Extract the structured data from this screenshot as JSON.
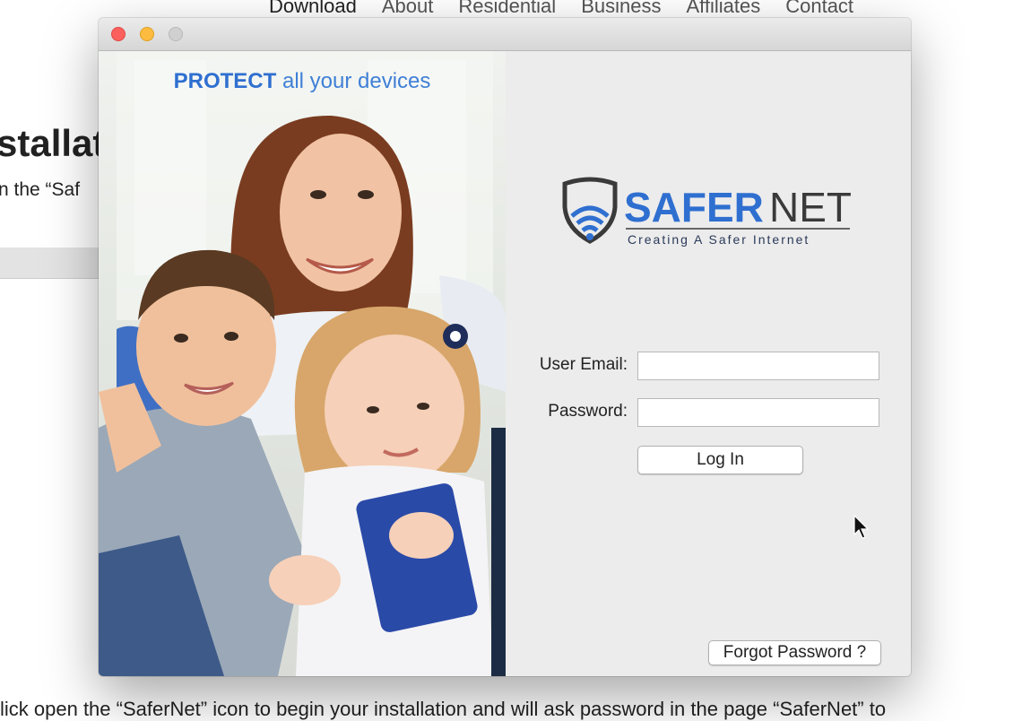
{
  "background_page": {
    "nav": [
      "Download",
      "About",
      "Residential",
      "Business",
      "Affiliates",
      "Contact"
    ],
    "heading": "stallat",
    "text": "n the “Saf",
    "bottom_text": "lick open the “SaferNet” icon to begin your installation and will ask password in the page “SaferNet” to"
  },
  "window": {
    "buttons": [
      "close",
      "minimize",
      "zoom"
    ]
  },
  "promo": {
    "bold": "PROTECT",
    "rest": " all your devices"
  },
  "logo": {
    "brand_part1": "SAFER",
    "brand_part2": "NET",
    "tagline": "Creating A Safer Internet",
    "icon": "shield-wifi-icon"
  },
  "form": {
    "email_label": "User Email:",
    "email_value": "",
    "password_label": "Password:",
    "password_value": "",
    "login_button": "Log In",
    "forgot_button": "Forgot Password ?"
  },
  "colors": {
    "brand_blue": "#3f7fd6",
    "logo_dark": "#3a3a3a"
  }
}
